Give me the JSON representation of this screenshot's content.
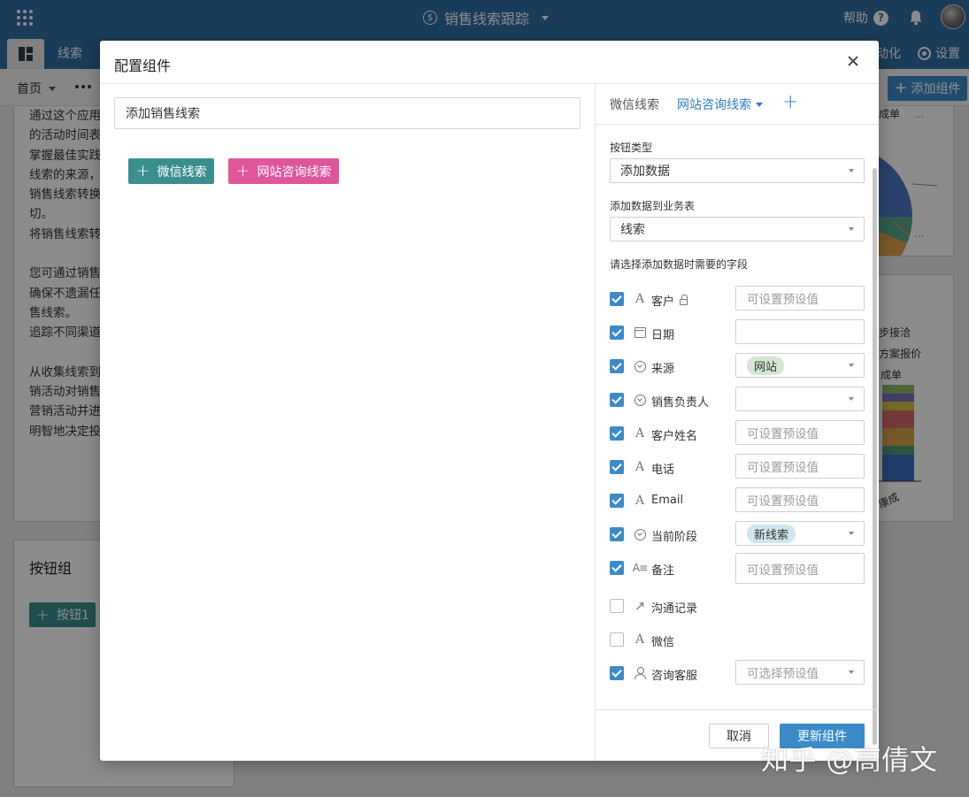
{
  "app": {
    "title": "销售线索跟踪",
    "help_label": "帮助",
    "tabs": {
      "leads": "线索",
      "automation": "动化",
      "settings": "设置"
    },
    "toolbar": {
      "home": "首页",
      "add_widget": "添加组件"
    }
  },
  "background": {
    "text_widget_lines": [
      "通过这个应用",
      "的活动时间表",
      "掌握最佳实践",
      "线索的来源，",
      "销售线索转换",
      "切。",
      "将销售线索转",
      "",
      "您可通过销售",
      "确保不遗漏任",
      "售线索。",
      "追踪不同渠道",
      "",
      "从收集线索到",
      "销活动对销售",
      "营销活动并进",
      "明智地决定投"
    ],
    "button_group": {
      "title": "按钮组",
      "button1": "按钮1"
    },
    "chart1_labels": {
      "top": "成单",
      "right": "...",
      "bottom": "..."
    },
    "chart2_labels": {
      "l1": "步接洽",
      "l2": "方案报价",
      "l3": "成单",
      "xlabel": "康成"
    },
    "chart2_colors": [
      "#8fb66b",
      "#7b6fc0",
      "#d6c04a",
      "#d46a6a",
      "#d6a04a",
      "#4f9d7a",
      "#3b6fbf"
    ],
    "chart1_colors": {
      "blue": "#4a78c4",
      "green": "#5aa68a",
      "orange": "#e0a04a"
    }
  },
  "modal": {
    "title": "配置组件",
    "title_input_value": "添加销售线索",
    "buttons": {
      "wechat": "微信线索",
      "web": "网站咨询线索"
    },
    "right_tabs": {
      "wechat": "微信线索",
      "web": "网站咨询线索"
    },
    "button_type_label": "按钮类型",
    "button_type_value": "添加数据",
    "target_table_label": "添加数据到业务表",
    "target_table_value": "线索",
    "fields_label": "请选择添加数据时需要的字段",
    "fields": [
      {
        "name": "客户",
        "checked": true,
        "icon": "text-icon",
        "value": "",
        "placeholder": "可设置预设值",
        "locked": true
      },
      {
        "name": "日期",
        "checked": true,
        "icon": "calendar-icon",
        "value": "",
        "placeholder": ""
      },
      {
        "name": "来源",
        "checked": true,
        "icon": "option-icon",
        "value": "网站",
        "tag": "green",
        "dropdown": true
      },
      {
        "name": "销售负责人",
        "checked": true,
        "icon": "option-icon",
        "value": "",
        "dropdown": true
      },
      {
        "name": "客户姓名",
        "checked": true,
        "icon": "text-icon",
        "placeholder": "可设置预设值"
      },
      {
        "name": "电话",
        "checked": true,
        "icon": "text-icon",
        "placeholder": "可设置预设值"
      },
      {
        "name": "Email",
        "checked": true,
        "icon": "text-icon",
        "placeholder": "可设置预设值"
      },
      {
        "name": "当前阶段",
        "checked": true,
        "icon": "option-icon",
        "value": "新线索",
        "tag": "blue",
        "dropdown": true
      },
      {
        "name": "备注",
        "checked": true,
        "icon": "long-text-icon",
        "placeholder": "可设置预设值"
      },
      {
        "name": "沟通记录",
        "checked": false,
        "icon": "link-icon"
      },
      {
        "name": "微信",
        "checked": false,
        "icon": "text-icon"
      },
      {
        "name": "咨询客服",
        "checked": true,
        "icon": "user-icon",
        "placeholder": "可选择预设值",
        "dropdown": true
      }
    ],
    "cancel_label": "取消",
    "update_label": "更新组件"
  },
  "watermark": "知乎 @高倩文",
  "colors": {
    "primary": "#2f6da3",
    "accent_blue": "#3b8bc9",
    "teal": "#3a8f8e",
    "pink": "#e0569b"
  }
}
